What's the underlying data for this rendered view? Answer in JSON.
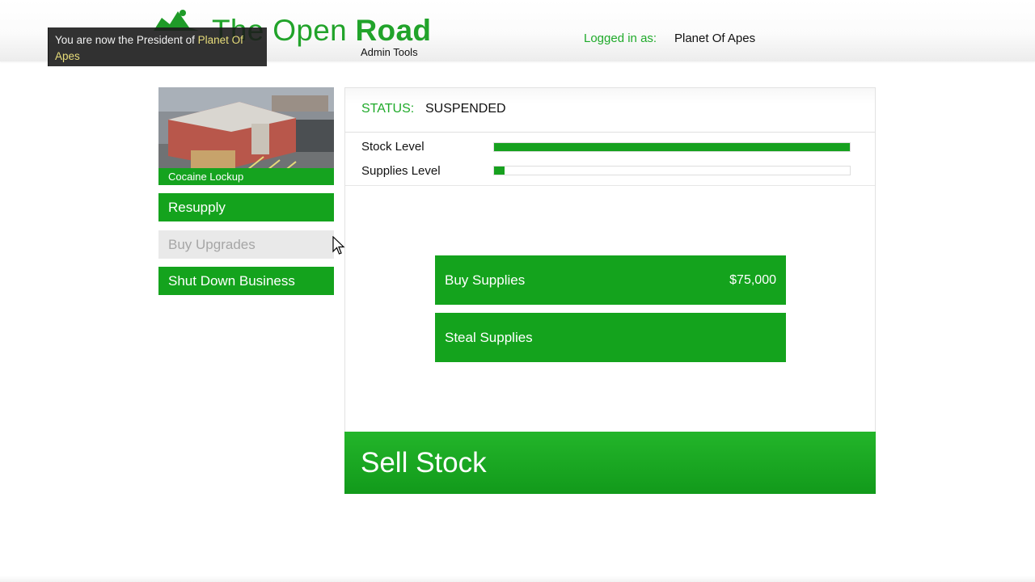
{
  "header": {
    "logo_title_light": "The Open ",
    "logo_title_bold": "Road",
    "logo_subtitle": "Admin Tools",
    "logged_in_label": "Logged in as:",
    "logged_in_user": "Planet Of Apes"
  },
  "notification": {
    "text": "You are now the President of ",
    "highlight": "Planet Of Apes"
  },
  "business": {
    "name": "Cocaine Lockup"
  },
  "sidebar": {
    "items": [
      {
        "label": "Resupply",
        "state": "active"
      },
      {
        "label": "Buy Upgrades",
        "state": "disabled"
      },
      {
        "label": "Shut Down Business",
        "state": "active"
      }
    ]
  },
  "status": {
    "label": "STATUS:",
    "value": "SUSPENDED"
  },
  "meters": {
    "stock": {
      "label": "Stock Level",
      "fraction": 1.0
    },
    "supplies": {
      "label": "Supplies Level",
      "fraction": 0.03
    }
  },
  "actions": {
    "buy_supplies": {
      "label": "Buy Supplies",
      "price": "$75,000"
    },
    "steal_supplies": {
      "label": "Steal Supplies"
    }
  },
  "sell": {
    "label": "Sell Stock"
  },
  "colors": {
    "accent_green": "#14a31d",
    "label_green": "#1faa2a",
    "disabled_gray": "#e9e9e9",
    "notification_highlight": "#e8dd7a"
  }
}
